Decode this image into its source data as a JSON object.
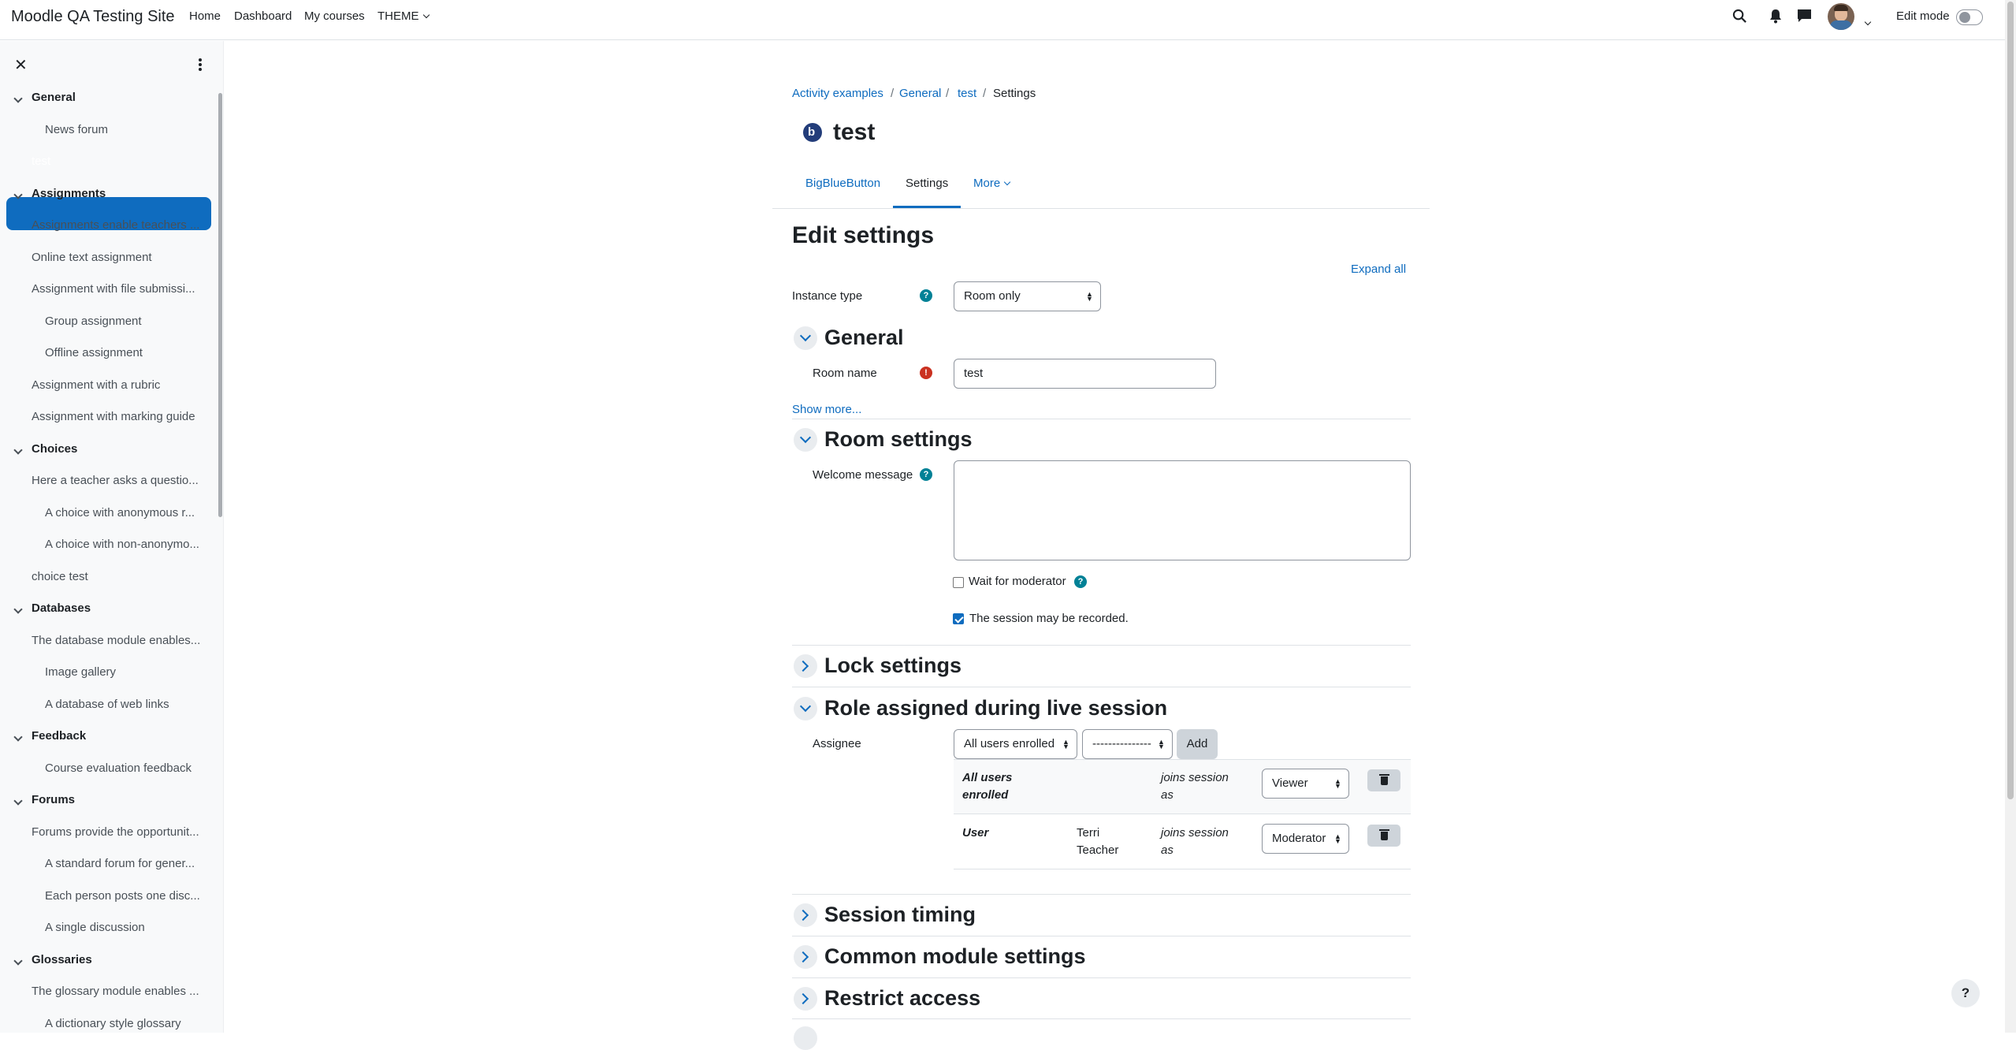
{
  "navbar": {
    "brand": "Moodle QA Testing Site",
    "links": [
      "Home",
      "Dashboard",
      "My courses",
      "THEME"
    ],
    "edit_mode_label": "Edit mode"
  },
  "drawer": {
    "sections": [
      {
        "title": "General",
        "items": [
          {
            "label": "News forum",
            "indent": 2
          },
          {
            "label": "test",
            "indent": 1,
            "active": true
          }
        ]
      },
      {
        "title": "Assignments",
        "items": [
          {
            "label": "Assignments enable teachers ...",
            "indent": 1
          },
          {
            "label": "Online text assignment",
            "indent": 1
          },
          {
            "label": "Assignment with file submissi...",
            "indent": 1
          },
          {
            "label": "Group assignment",
            "indent": 2
          },
          {
            "label": "Offline assignment",
            "indent": 2
          },
          {
            "label": "Assignment with a rubric",
            "indent": 1
          },
          {
            "label": "Assignment with marking guide",
            "indent": 1
          }
        ]
      },
      {
        "title": "Choices",
        "items": [
          {
            "label": "Here a teacher asks a questio...",
            "indent": 1
          },
          {
            "label": "A choice with anonymous r...",
            "indent": 2
          },
          {
            "label": "A choice with non-anonymo...",
            "indent": 2
          },
          {
            "label": "choice test",
            "indent": 1
          }
        ]
      },
      {
        "title": "Databases",
        "items": [
          {
            "label": "The database module enables...",
            "indent": 1
          },
          {
            "label": "Image gallery",
            "indent": 2
          },
          {
            "label": "A database of web links",
            "indent": 2
          }
        ]
      },
      {
        "title": "Feedback",
        "items": [
          {
            "label": "Course evaluation feedback",
            "indent": 2
          }
        ]
      },
      {
        "title": "Forums",
        "items": [
          {
            "label": "Forums provide the opportunit...",
            "indent": 1
          },
          {
            "label": "A standard forum for gener...",
            "indent": 2
          },
          {
            "label": "Each person posts one disc...",
            "indent": 2
          },
          {
            "label": "A single discussion",
            "indent": 2
          }
        ]
      },
      {
        "title": "Glossaries",
        "items": [
          {
            "label": "The glossary module enables ...",
            "indent": 1
          },
          {
            "label": "A dictionary style glossary",
            "indent": 2
          }
        ]
      }
    ]
  },
  "breadcrumb": [
    "Activity examples",
    "General",
    "test",
    "Settings"
  ],
  "page_title": "test",
  "tabs": [
    "BigBlueButton",
    "Settings",
    "More"
  ],
  "heading": "Edit settings",
  "expand_all": "Expand all",
  "instance_type": {
    "label": "Instance type",
    "value": "Room only"
  },
  "sections": {
    "general": "General",
    "room_settings": "Room settings",
    "lock_settings": "Lock settings",
    "role_assigned": "Role assigned during live session",
    "session_timing": "Session timing",
    "common_module": "Common module settings",
    "restrict_access": "Restrict access"
  },
  "room_name": {
    "label": "Room name",
    "value": "test"
  },
  "show_more": "Show more...",
  "welcome_message": {
    "label": "Welcome message",
    "value": ""
  },
  "wait_for_moderator": {
    "label": "Wait for moderator",
    "checked": false
  },
  "session_recorded": {
    "label": "The session may be recorded.",
    "checked": true
  },
  "assignee": {
    "label": "Assignee",
    "type_select": "All users enrolled",
    "user_select": "---------------",
    "add_button": "Add",
    "rows": [
      {
        "type": "All users enrolled",
        "name": "",
        "joins": "joins session as",
        "role": "Viewer"
      },
      {
        "type": "User",
        "name": "Terri Teacher",
        "joins": "joins session as",
        "role": "Moderator"
      }
    ]
  },
  "help_button": "?",
  "colors": {
    "primary": "#0f6cbf",
    "help": "#008196",
    "required": "#ca3120"
  },
  "icons": [
    "search-icon",
    "bell-icon",
    "chat-icon",
    "close-icon",
    "kebab-icon",
    "help-icon",
    "trash-icon"
  ]
}
